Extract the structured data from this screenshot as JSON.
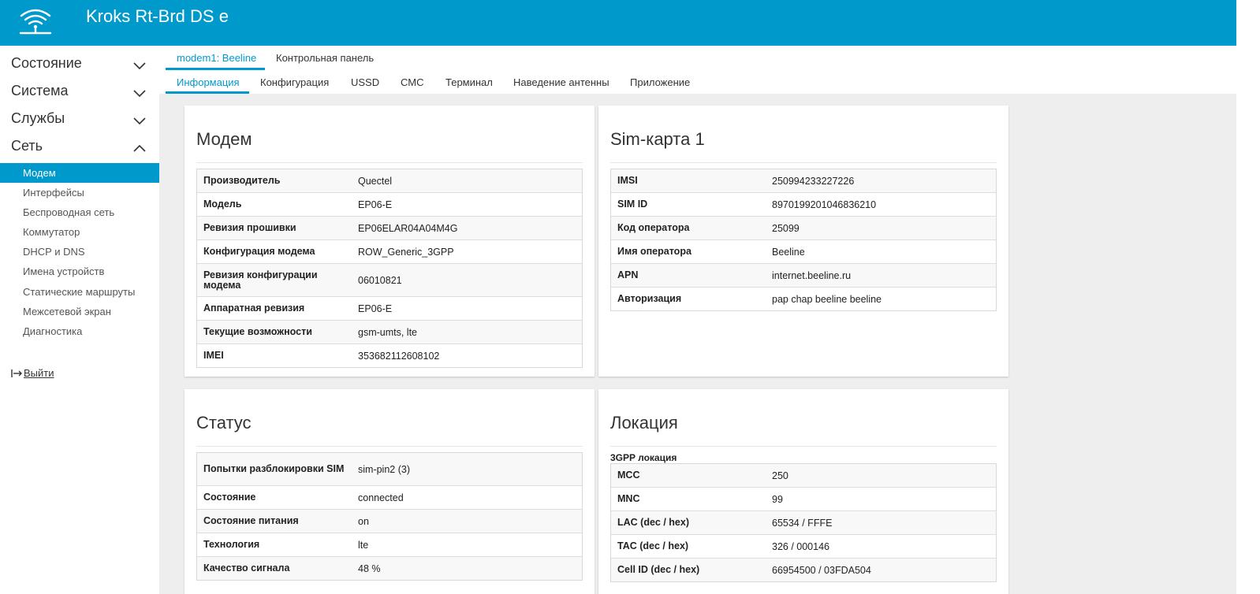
{
  "app": {
    "title": "Kroks Rt-Brd DS e"
  },
  "sidebar": {
    "sections": [
      {
        "label": "Состояние",
        "expanded": false
      },
      {
        "label": "Система",
        "expanded": false
      },
      {
        "label": "Службы",
        "expanded": false
      },
      {
        "label": "Сеть",
        "expanded": true
      }
    ],
    "items": [
      {
        "label": "Модем",
        "active": true
      },
      {
        "label": "Интерфейсы"
      },
      {
        "label": "Беспроводная сеть"
      },
      {
        "label": "Коммутатор"
      },
      {
        "label": "DHCP и DNS"
      },
      {
        "label": "Имена устройств"
      },
      {
        "label": "Статические маршруты"
      },
      {
        "label": "Межсетевой экран"
      },
      {
        "label": "Диагностика"
      }
    ],
    "logout": "Выйти"
  },
  "tabs_top": [
    {
      "label": "modem1: Beeline",
      "active": true
    },
    {
      "label": "Контрольная панель"
    }
  ],
  "tabs_sub": [
    {
      "label": "Информация",
      "active": true
    },
    {
      "label": "Конфигурация"
    },
    {
      "label": "USSD"
    },
    {
      "label": "СМС"
    },
    {
      "label": "Терминал"
    },
    {
      "label": "Наведение антенны"
    },
    {
      "label": "Приложение"
    }
  ],
  "cards": {
    "modem": {
      "title": "Модем",
      "rows": [
        [
          "Производитель",
          "Quectel"
        ],
        [
          "Модель",
          "EP06-E"
        ],
        [
          "Ревизия прошивки",
          "EP06ELAR04A04M4G"
        ],
        [
          "Конфигурация модема",
          "ROW_Generic_3GPP"
        ],
        [
          "Ревизия конфигурации модема",
          "06010821"
        ],
        [
          "Аппаратная ревизия",
          "EP06-E"
        ],
        [
          "Текущие возможности",
          "gsm-umts, lte"
        ],
        [
          "IMEI",
          "353682112608102"
        ]
      ]
    },
    "sim": {
      "title": "Sim-карта 1",
      "rows": [
        [
          "IMSI",
          "250994233227226"
        ],
        [
          "SIM ID",
          "8970199201046836210"
        ],
        [
          "Код оператора",
          "25099"
        ],
        [
          "Имя оператора",
          "Beeline"
        ],
        [
          "APN",
          "internet.beeline.ru"
        ],
        [
          "Авторизация",
          "pap chap beeline beeline"
        ]
      ]
    },
    "status": {
      "title": "Статус",
      "rows": [
        [
          "Попытки разблокировки SIM",
          "sim-pin2 (3)"
        ],
        [
          "Состояние",
          "connected"
        ],
        [
          "Состояние питания",
          "on"
        ],
        [
          "Технология",
          "lte"
        ],
        [
          "Качество сигнала",
          "48 %"
        ]
      ]
    },
    "location": {
      "title": "Локация",
      "subtitle": "3GPP локация",
      "rows": [
        [
          "MCC",
          "250"
        ],
        [
          "MNC",
          "99"
        ],
        [
          "LAC (dec / hex)",
          "65534 / FFFE"
        ],
        [
          "TAC (dec / hex)",
          "326 / 000146"
        ],
        [
          "Cell ID (dec / hex)",
          "66954500 / 03FDA504"
        ]
      ]
    }
  },
  "colors": {
    "accent": "#0099cc",
    "content_bg": "#eeeeee"
  }
}
